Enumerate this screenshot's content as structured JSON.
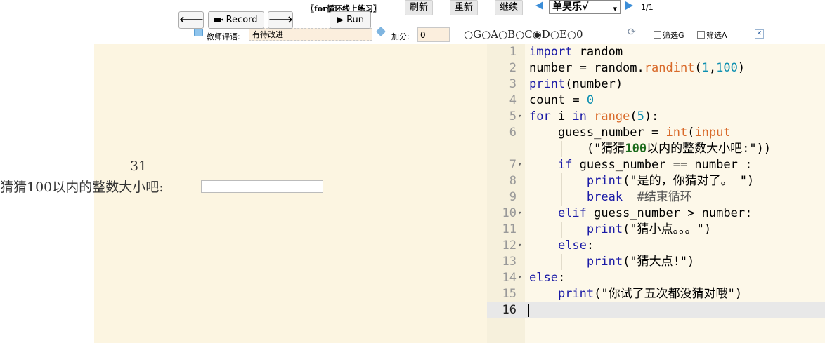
{
  "toolbar": {
    "lesson_title": "〖for循环线上练习〗",
    "refresh_label": "刷新",
    "reset_label": "重新",
    "continue_label": "继续",
    "student_name": "单昊乐√",
    "page_counter": "1/1"
  },
  "review": {
    "comment_label": "教师评语:",
    "comment_value": "有待改进",
    "bonus_label": "加分:",
    "bonus_value": "0",
    "grades": [
      "G",
      "A",
      "B",
      "C",
      "D",
      "E",
      "0"
    ],
    "selected_grade": "D",
    "filter_g_label": "筛选G",
    "filter_a_label": "筛选A"
  },
  "player": {
    "record_label": "Record",
    "run_label": "Run"
  },
  "output": {
    "number": "31",
    "prompt": "猜猜100以内的整数大小吧:"
  },
  "editor": {
    "line_numbers": [
      "1",
      "2",
      "3",
      "4",
      "5",
      "6",
      "",
      "7",
      "8",
      "9",
      "10",
      "11",
      "12",
      "13",
      "14",
      "15",
      "16"
    ],
    "lines": [
      "import random",
      "number = random.randint(1,100)",
      "print(number)",
      "count = 0",
      "for i in range(5):",
      "    guess_number = int(input",
      "        (\"猜猜100以内的整数大小吧:\"))",
      "    if guess_number == number :",
      "        print(\"是的，你猜对了。 \")",
      "        break  #结束循环",
      "    elif guess_number > number:",
      "        print(\"猜小点。。。\")",
      "    else:",
      "        print(\"猜大点!\")",
      "else:",
      "    print(\"你试了五次都没猜对哦\")",
      ""
    ]
  },
  "colors": {
    "output_bg": "#fcf5e1",
    "editor_bg": "#fdf8e9",
    "keyword": "#1a1aa6",
    "function": "#d96a2a",
    "number": "#0c8fb0"
  }
}
